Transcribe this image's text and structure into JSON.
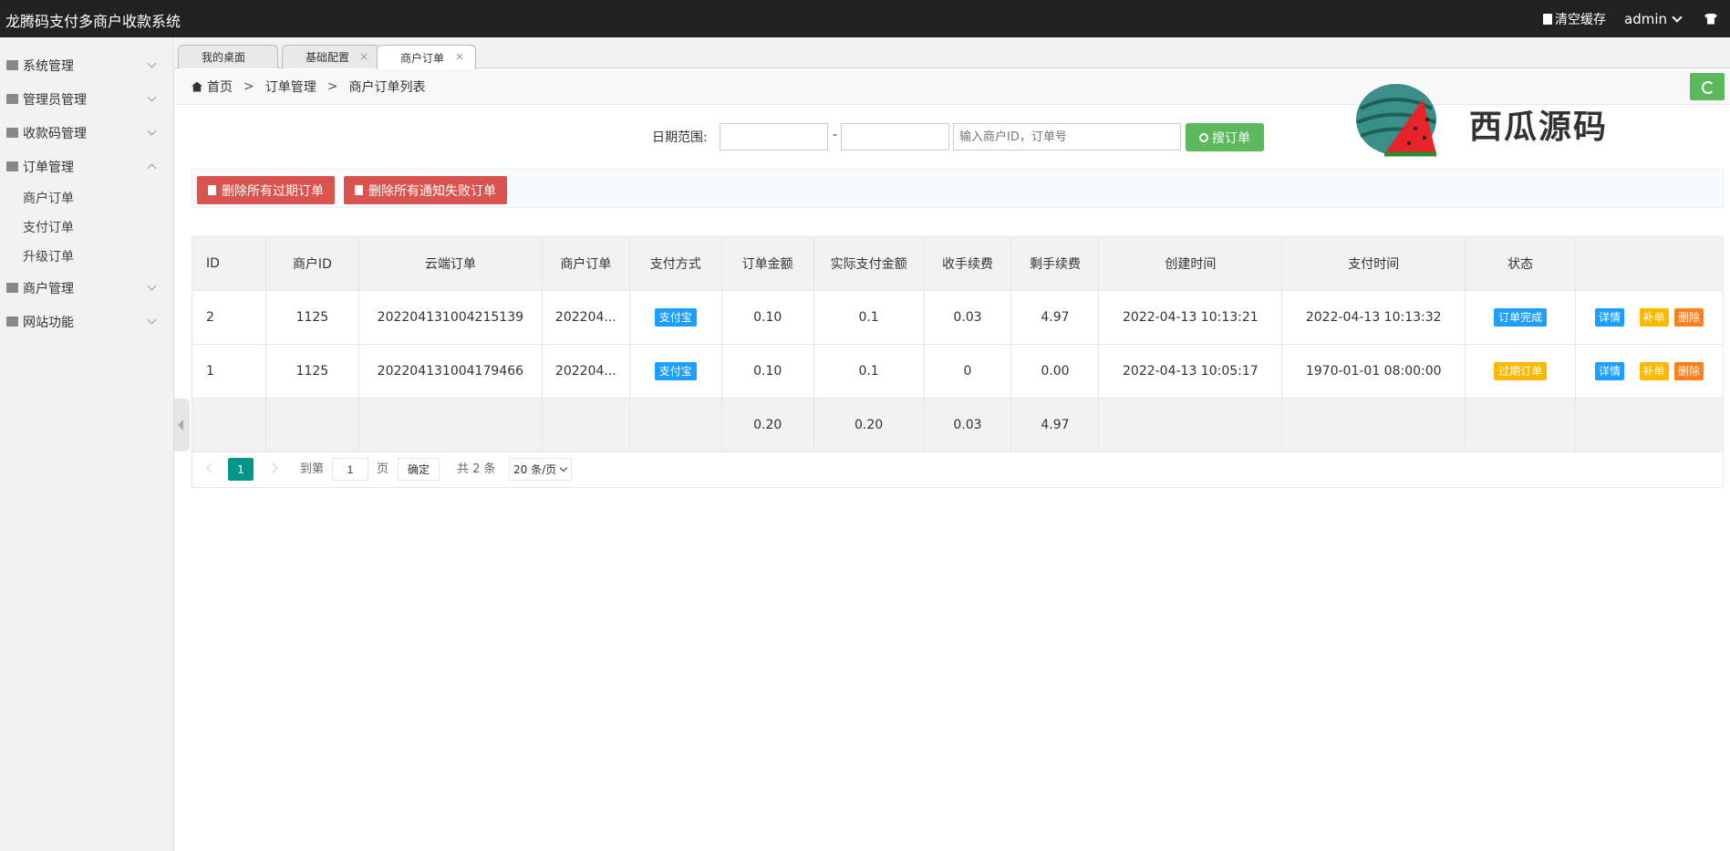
{
  "header": {
    "title": "龙腾码支付多商户收款系统",
    "clear_cache": "清空缓存",
    "user": "admin"
  },
  "sidebar": {
    "items": [
      {
        "label": "系统管理",
        "icon": "tools-icon"
      },
      {
        "label": "管理员管理",
        "icon": "user-icon"
      },
      {
        "label": "收款码管理",
        "icon": "list-icon"
      },
      {
        "label": "订单管理",
        "icon": "card-icon",
        "expanded": true
      },
      {
        "label": "商户管理",
        "icon": "merchant-icon"
      },
      {
        "label": "网站功能",
        "icon": "window-icon"
      }
    ],
    "order_sub": [
      "商户订单",
      "支付订单",
      "升级订单"
    ]
  },
  "tabs": [
    {
      "label": "我的桌面"
    },
    {
      "label": "基础配置",
      "close": "×"
    },
    {
      "label": "商户订单",
      "close": "×"
    }
  ],
  "breadcrumb": [
    "首页",
    "订单管理",
    "商户订单列表"
  ],
  "breadcrumb_sep": ">",
  "search": {
    "date_label": "日期范围:",
    "dash": "-",
    "keyword_placeholder": "输入商户ID，订单号",
    "button": "搜订单"
  },
  "watermark": "西瓜源码",
  "actions": {
    "delete_expired": "删除所有过期订单",
    "delete_failed": "删除所有通知失败订单"
  },
  "table": {
    "headers": [
      "ID",
      "商户ID",
      "云端订单",
      "商户订单",
      "支付方式",
      "订单金额",
      "实际支付金额",
      "收手续费",
      "剩手续费",
      "创建时间",
      "支付时间",
      "状态",
      ""
    ],
    "rows": [
      {
        "id": "2",
        "merchant_id": "1125",
        "cloud_order": "202204131004215139",
        "merchant_order": "202204...",
        "pay": "支付宝",
        "amount": "0.10",
        "paid": "0.1",
        "fee_in": "0.03",
        "fee_left": "4.97",
        "created": "2022-04-13 10:13:21",
        "paid_at": "2022-04-13 10:13:32",
        "status": "订单完成",
        "status_color": "#1e9fff"
      },
      {
        "id": "1",
        "merchant_id": "1125",
        "cloud_order": "202204131004179466",
        "merchant_order": "202204...",
        "pay": "支付宝",
        "amount": "0.10",
        "paid": "0.1",
        "fee_in": "0",
        "fee_left": "0.00",
        "created": "2022-04-13 10:05:17",
        "paid_at": "1970-01-01 08:00:00",
        "status": "过期订单",
        "status_color": "#ffb800"
      }
    ],
    "ops": {
      "detail": "详情",
      "supplement": "补单",
      "delete": "删除"
    },
    "summary": {
      "amount": "0.20",
      "paid": "0.20",
      "fee_in": "0.03",
      "fee_left": "4.97"
    }
  },
  "pager": {
    "current": "1",
    "goto": "到第",
    "page_input": "1",
    "page_unit": "页",
    "confirm": "确定",
    "total": "共 2 条",
    "page_size": "20 条/页"
  },
  "colors": {
    "header_bg": "#222222",
    "success": "#5cb85c",
    "danger": "#d9534f",
    "primary": "#1e9fff",
    "warning": "#ffb800",
    "pager_active": "#009688"
  }
}
